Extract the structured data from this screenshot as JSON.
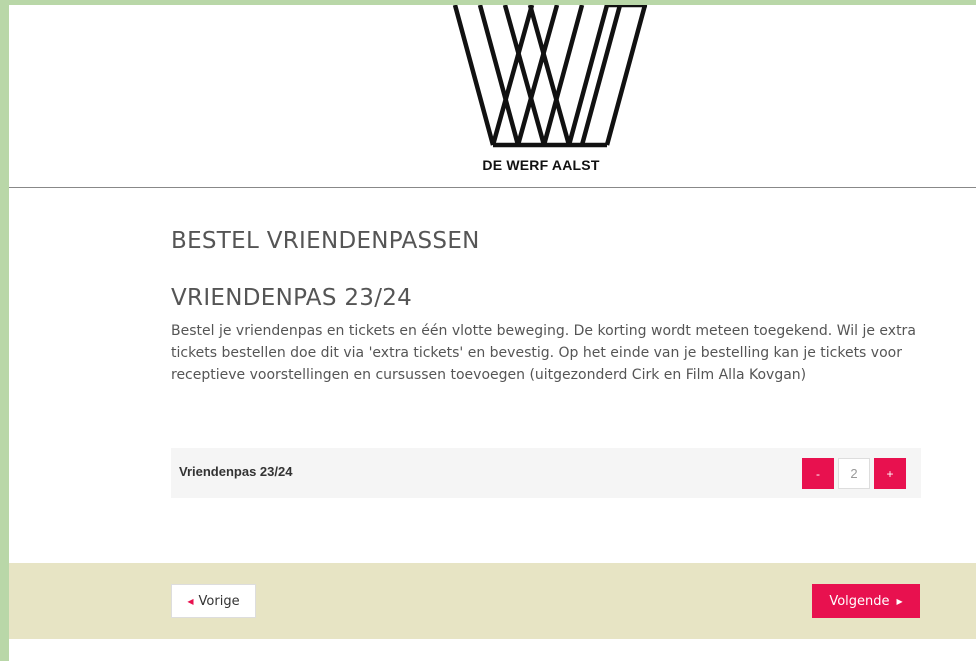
{
  "brand": {
    "name": "DE WERF AALST",
    "accent_color": "#e8114f",
    "nav_background": "#e7e4c4",
    "frame_color": "#b9d7a8"
  },
  "page": {
    "title": "BESTEL VRIENDENPASSEN",
    "section_title": "VRIENDENPAS 23/24",
    "description": "Bestel je vriendenpas en tickets en één vlotte beweging. De korting wordt meteen toegekend. Wil je extra tickets bestellen doe dit via 'extra tickets' en bevestig. Op het einde van je bestelling kan je tickets voor receptieve voorstellingen en cursussen toevoegen (uitgezonderd Cirk en Film Alla Kovgan)"
  },
  "product": {
    "name": "Vriendenpas 23/24",
    "quantity": "2",
    "decrement_label": "-",
    "increment_label": "+"
  },
  "navigation": {
    "prev_label": "Vorige",
    "next_label": "Volgende",
    "prev_icon": "caret-left-icon",
    "next_icon": "caret-right-icon"
  }
}
